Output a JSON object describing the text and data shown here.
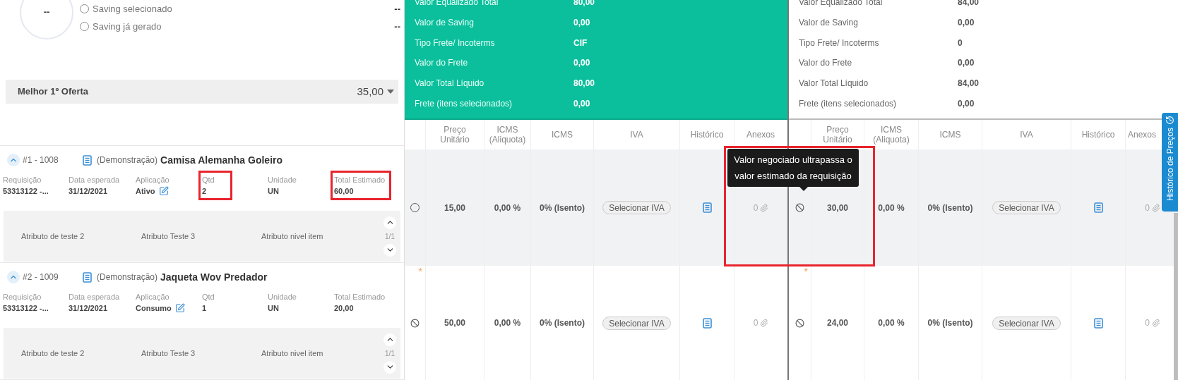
{
  "savings": {
    "gauge_value": "--",
    "options": [
      {
        "label": "Saving selecionado",
        "value": "--",
        "selected": false
      },
      {
        "label": "Saving já gerado",
        "value": "--",
        "selected": false
      }
    ]
  },
  "best_offer": {
    "label": "Melhor 1º Oferta",
    "value": "35,00"
  },
  "items": [
    {
      "number": "#1 - 1008",
      "expanded": true,
      "prefix": "(Demonstração)",
      "name": "Camisa Alemanha Goleiro",
      "fields": [
        {
          "label": "Requisição",
          "value": "53313122 -...",
          "editable": false,
          "highlighted": false
        },
        {
          "label": "Data esperada",
          "value": "31/12/2021",
          "editable": false,
          "highlighted": false
        },
        {
          "label": "Aplicação",
          "value": "Ativo",
          "editable": true,
          "highlighted": false
        },
        {
          "label": "Qtd",
          "value": "2",
          "editable": false,
          "highlighted": true
        },
        {
          "label": "Unidade",
          "value": "UN",
          "editable": false,
          "highlighted": false
        },
        {
          "label": "Total Estimado",
          "value": "60,00",
          "editable": false,
          "highlighted": true
        }
      ],
      "attributes": [
        "Atributo de teste 2",
        "Atributo Teste 3",
        "Atributo nivel item"
      ],
      "pager": "1/1"
    },
    {
      "number": "#2 - 1009",
      "expanded": true,
      "prefix": "(Demonstração)",
      "name": "Jaqueta Wov Predador",
      "fields": [
        {
          "label": "Requisição",
          "value": "53313122 -...",
          "editable": false,
          "highlighted": false
        },
        {
          "label": "Data esperada",
          "value": "31/12/2021",
          "editable": false,
          "highlighted": false
        },
        {
          "label": "Aplicação",
          "value": "Consumo",
          "editable": true,
          "highlighted": false
        },
        {
          "label": "Qtd",
          "value": "1",
          "editable": false,
          "highlighted": false
        },
        {
          "label": "Unidade",
          "value": "UN",
          "editable": false,
          "highlighted": false
        },
        {
          "label": "Total Estimado",
          "value": "20,00",
          "editable": false,
          "highlighted": false
        }
      ],
      "attributes": [
        "Atributo de teste 2",
        "Atributo Teste 3",
        "Atributo nivel item"
      ],
      "pager": "1/1"
    }
  ],
  "suppliers": [
    {
      "highlighted": true,
      "summary": [
        {
          "label": "Valor Equalizado Total",
          "value": "80,00"
        },
        {
          "label": "Valor de Saving",
          "value": "0,00"
        },
        {
          "label": "Tipo Frete/ Incoterms",
          "value": "CIF"
        },
        {
          "label": "Valor do Frete",
          "value": "0,00"
        },
        {
          "label": "Valor Total Líquido",
          "value": "80,00"
        },
        {
          "label": "Frete (itens selecionados)",
          "value": "0,00"
        }
      ],
      "columns": [
        "Preço Unitário",
        "ICMS (Aliquota)",
        "ICMS",
        "IVA",
        "Histórico",
        "Anexos"
      ],
      "rows": [
        {
          "highlighted": true,
          "status": {
            "kind": "radio",
            "selected": false
          },
          "cells": [
            "15,00",
            "0,00 %",
            "0% (Isento)"
          ],
          "iva_button": "Selecionar IVA",
          "attachments": "0"
        },
        {
          "highlighted": false,
          "marker": "*",
          "status": {
            "kind": "blocked"
          },
          "cells": [
            "50,00",
            "0,00 %",
            "0% (Isento)"
          ],
          "iva_button": "Selecionar IVA",
          "attachments": "0"
        }
      ]
    },
    {
      "highlighted": false,
      "summary": [
        {
          "label": "Valor Equalizado Total",
          "value": "84,00"
        },
        {
          "label": "Valor de Saving",
          "value": "0,00"
        },
        {
          "label": "Tipo Frete/ Incoterms",
          "value": "0"
        },
        {
          "label": "Valor do Frete",
          "value": "0,00"
        },
        {
          "label": "Valor Total Líquido",
          "value": "84,00"
        },
        {
          "label": "Frete (itens selecionados)",
          "value": "0,00"
        }
      ],
      "columns": [
        "Preço Unitário",
        "ICMS (Aliquota)",
        "ICMS",
        "IVA",
        "Histórico",
        "Anexos"
      ],
      "rows": [
        {
          "highlighted": true,
          "status": {
            "kind": "blocked"
          },
          "cells": [
            "30,00",
            "0,00 %",
            "0% (Isento)"
          ],
          "iva_button": "Selecionar IVA",
          "attachments": "0"
        },
        {
          "highlighted": false,
          "marker": "*",
          "status": {
            "kind": "blocked"
          },
          "cells": [
            "24,00",
            "0,00 %",
            "0% (Isento)"
          ],
          "iva_button": "Selecionar IVA",
          "attachments": "0"
        }
      ]
    }
  ],
  "tooltip": {
    "text": "Valor negociado ultrapassa o valor estimado da requisição",
    "framed": true
  },
  "side_tab": {
    "label": "Histórico de Preços"
  }
}
